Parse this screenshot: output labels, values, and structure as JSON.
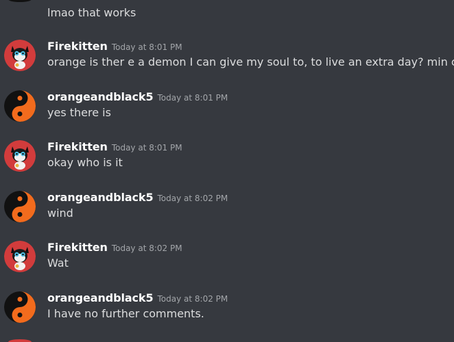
{
  "channel": {
    "orphan_message": "lmao that works"
  },
  "users": {
    "firekitten": {
      "name": "Firekitten",
      "avatar_icon": "firekitten-avatar-icon",
      "color": "#ffffff"
    },
    "orange": {
      "name": "orangeandblack5",
      "avatar_icon": "yin-yang-avatar-icon",
      "color": "#ffffff"
    }
  },
  "messages": [
    {
      "author": "Firekitten",
      "time": "Today at 8:01 PM",
      "text": "orange is ther e a demon I can give my soul to, to live an extra day? min claimed"
    },
    {
      "author": "orangeandblack5",
      "time": "Today at 8:01 PM",
      "text": "yes there is"
    },
    {
      "author": "Firekitten",
      "time": "Today at 8:01 PM",
      "text": "okay who is it"
    },
    {
      "author": "orangeandblack5",
      "time": "Today at 8:02 PM",
      "text": "wind"
    },
    {
      "author": "Firekitten",
      "time": "Today at 8:02 PM",
      "text": "Wat"
    },
    {
      "author": "orangeandblack5",
      "time": "Today at 8:02 PM",
      "text": "I have no further comments."
    }
  ],
  "colors": {
    "background": "#36393f",
    "username": "#ffffff",
    "timestamp": "#a3a6aa",
    "message_text": "#dcddde",
    "yin_yang_orange": "#f26b1d",
    "firekitten_red": "#d23c3c"
  }
}
